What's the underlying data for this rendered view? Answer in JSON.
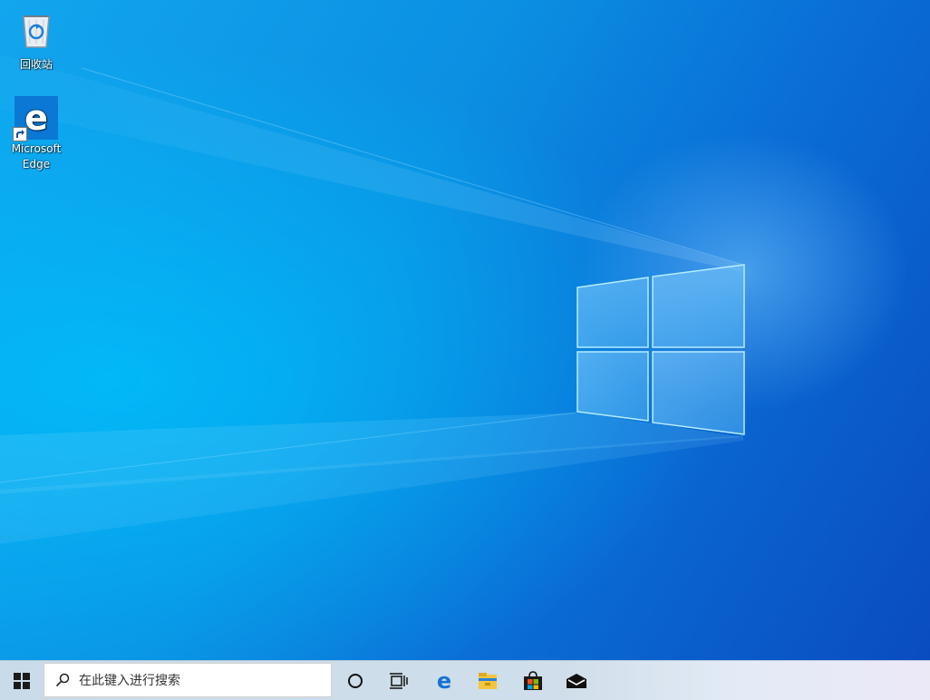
{
  "desktop": {
    "icons": [
      {
        "label": "回收站",
        "icon": "recycle-bin-icon"
      },
      {
        "label": "Microsoft Edge",
        "icon": "edge-icon"
      }
    ]
  },
  "taskbar": {
    "search_placeholder": "在此键入进行搜索",
    "buttons": [
      {
        "icon": "windows-start-icon"
      },
      {
        "icon": "cortana-circle-icon"
      },
      {
        "icon": "task-view-icon"
      },
      {
        "icon": "edge-icon"
      },
      {
        "icon": "file-explorer-icon"
      },
      {
        "icon": "microsoft-store-icon"
      },
      {
        "icon": "mail-icon"
      }
    ]
  },
  "colors": {
    "desktop_accent": "#0a78d4",
    "taskbar_bg": "#cfdeea"
  }
}
